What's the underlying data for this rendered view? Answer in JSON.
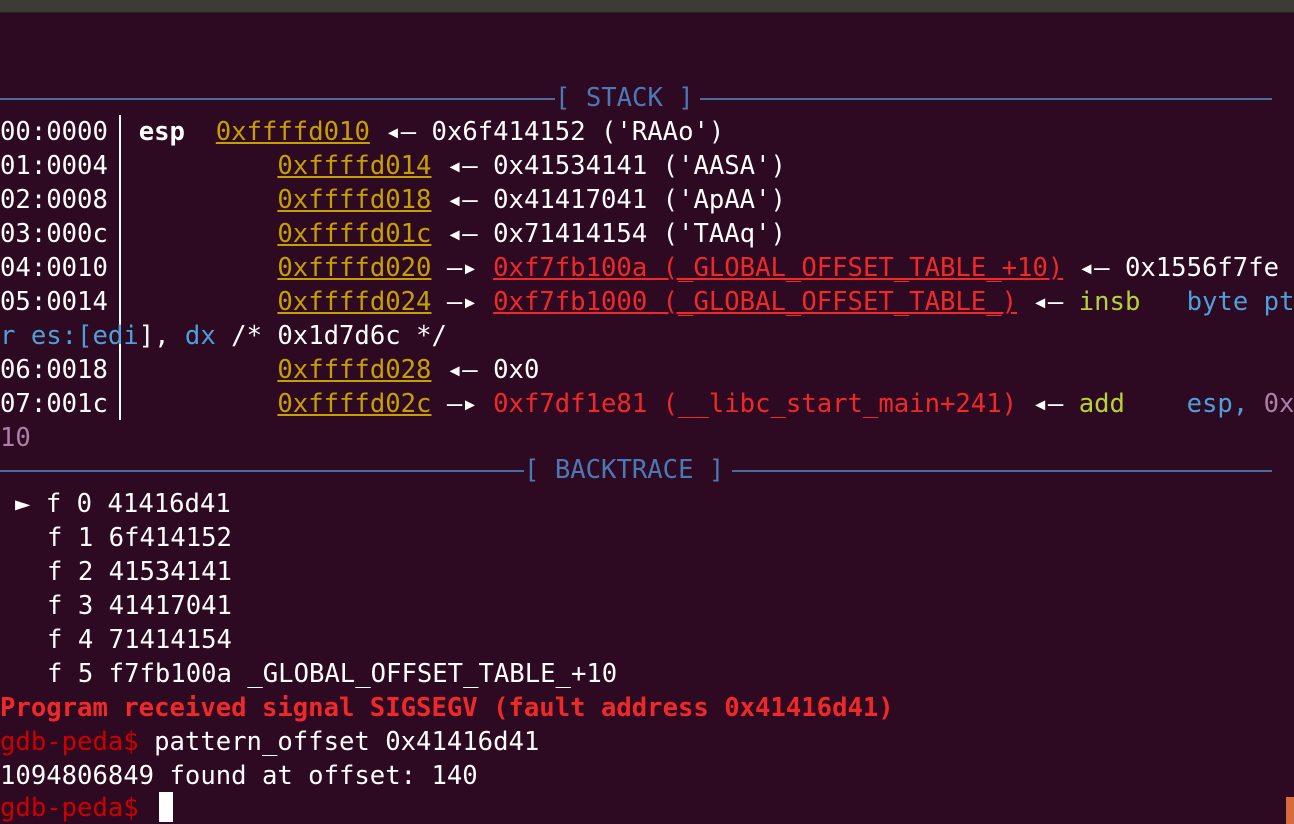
{
  "stack_header": "[ STACK ]",
  "backtrace_header": "[ BACKTRACE ]",
  "stack": [
    {
      "idx": "00:0000",
      "reg": "esp",
      "addr": "0xffffd010",
      "arrow": "◂—",
      "value": "0x6f414152 ('RAAo')"
    },
    {
      "idx": "01:0004",
      "reg": "",
      "addr": "0xffffd014",
      "arrow": "◂—",
      "value": "0x41534141 ('AASA')"
    },
    {
      "idx": "02:0008",
      "reg": "",
      "addr": "0xffffd018",
      "arrow": "◂—",
      "value": "0x41417041 ('ApAA')"
    },
    {
      "idx": "03:000c",
      "reg": "",
      "addr": "0xffffd01c",
      "arrow": "◂—",
      "value": "0x71414154 ('TAAq')"
    },
    {
      "idx": "04:0010",
      "reg": "",
      "addr": "0xffffd020",
      "arrow": "—▸",
      "target": "0xf7fb100a (_GLOBAL_OFFSET_TABLE_+10)",
      "arrow2": "◂—",
      "value": "0x1556f7fe"
    },
    {
      "idx": "05:0014",
      "reg": "",
      "addr": "0xffffd024",
      "arrow": "—▸",
      "target": "0xf7fb1000 (_GLOBAL_OFFSET_TABLE_)",
      "arrow2": "◂—",
      "mnemonic": "insb",
      "operand": "byte pt",
      "wrap_operand": "r es:[",
      "wrap_reg": "edi",
      "wrap_sep": "], ",
      "wrap_reg2": "dx",
      "wrap_comment": " /* 0x1d7d6c */"
    },
    {
      "idx": "06:0018",
      "reg": "",
      "addr": "0xffffd028",
      "arrow": "◂—",
      "value": "0x0"
    },
    {
      "idx": "07:001c",
      "reg": "",
      "addr": "0xffffd02c",
      "arrow": "—▸",
      "target": "0xf7df1e81 (__libc_start_main+241)",
      "arrow2": "◂—",
      "mnemonic": "add",
      "operand": "esp, ",
      "operand_num": "0x",
      "wrap_num": "10"
    }
  ],
  "backtrace": [
    {
      "marker": "►",
      "frame": "f 0",
      "addr": "41416d41",
      "sym": ""
    },
    {
      "marker": "",
      "frame": "f 1",
      "addr": "6f414152",
      "sym": ""
    },
    {
      "marker": "",
      "frame": "f 2",
      "addr": "41534141",
      "sym": ""
    },
    {
      "marker": "",
      "frame": "f 3",
      "addr": "41417041",
      "sym": ""
    },
    {
      "marker": "",
      "frame": "f 4",
      "addr": "71414154",
      "sym": ""
    },
    {
      "marker": "",
      "frame": "f 5",
      "addr": "f7fb100a",
      "sym": "_GLOBAL_OFFSET_TABLE_+10"
    }
  ],
  "signal_msg": "Program received signal SIGSEGV (fault address 0x41416d41)",
  "prompt": "gdb-peda$",
  "command": " pattern_offset 0x41416d41",
  "result": "1094806849 found at offset: 140",
  "colors": {
    "background": "#2d0922",
    "address": "#c4a000",
    "pointer_target": "#ef2929",
    "header": "#4b79b6",
    "mnemonic": "#b5d334",
    "operand": "#4f9fd8",
    "number": "#ad7fa8"
  }
}
